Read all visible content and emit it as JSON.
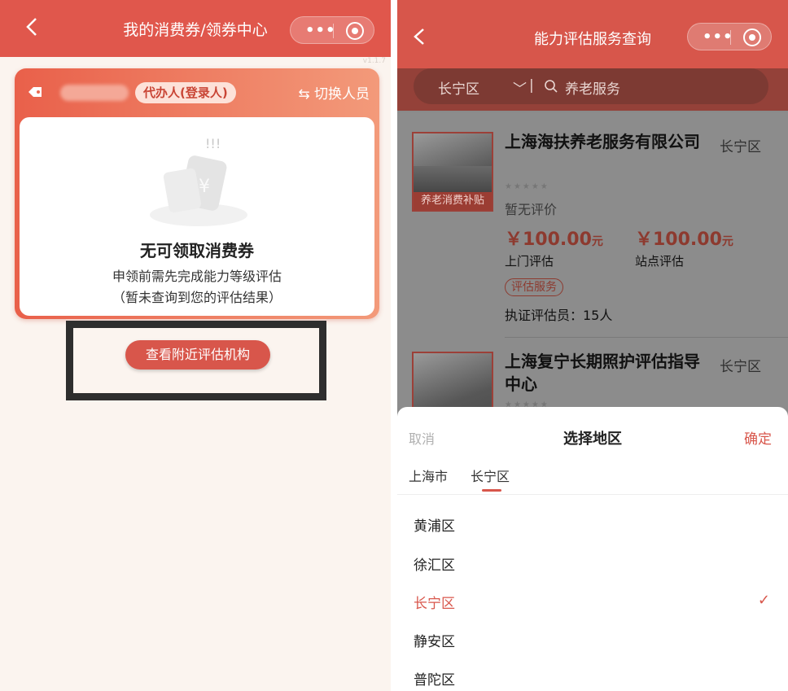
{
  "left": {
    "nav_title": "我的消费券/领券中心",
    "version": "v1.1.7",
    "agent_badge": "代办人(登录人)",
    "switch_label": "⇆ 切换人员",
    "empty_title": "无可领取消费券",
    "empty_line1": "申领前需先完成能力等级评估",
    "empty_line2": "（暂未查询到您的评估结果）",
    "find_button": "查看附近评估机构"
  },
  "right": {
    "nav_title": "能力评估服务查询",
    "search": {
      "district": "长宁区",
      "keyword": "养老服务"
    },
    "institutions": [
      {
        "name": "上海海扶养老服务有限公司",
        "district": "长宁区",
        "thumb_label": "养老消费补贴",
        "rating_text": "暂无评价",
        "price1": "￥100.00",
        "price1_unit": "元",
        "price1_label": "上门评估",
        "price2": "￥100.00",
        "price2_unit": "元",
        "price2_label": "站点评估",
        "service_tag": "评估服务",
        "assessors": "执证评估员：15人"
      },
      {
        "name": "上海复宁长期照护评估指导中心",
        "district": "长宁区"
      }
    ],
    "sheet": {
      "cancel": "取消",
      "title": "选择地区",
      "confirm": "确定",
      "tabs": [
        "上海市",
        "长宁区"
      ],
      "options": [
        "黄浦区",
        "徐汇区",
        "长宁区",
        "静安区",
        "普陀区"
      ],
      "selected_index": 2,
      "check_mark": "✓"
    }
  },
  "colors": {
    "brand_red": "#e0574c",
    "selected_red": "#d8564b",
    "overlay_dim": "#8a8a8a"
  }
}
